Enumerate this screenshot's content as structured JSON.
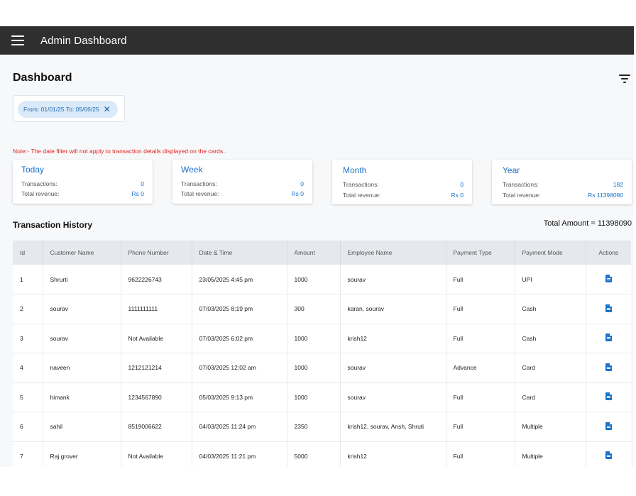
{
  "appbar": {
    "title": "Admin Dashboard",
    "menu_icon": "hamburger-menu-icon"
  },
  "page": {
    "title": "Dashboard",
    "filter_icon": "filter-list-icon"
  },
  "date_filter": {
    "chip_label": "From: 01/01/25 To: 05/06/25",
    "close_glyph": "✕"
  },
  "note": "Note:- The date filter will not apply to transaction details displayed on the cards..",
  "cards": [
    {
      "title": "Today",
      "transactions_label": "Transactions:",
      "transactions": "0",
      "revenue_label": "Total revenue:",
      "revenue": "Rs 0"
    },
    {
      "title": "Week",
      "transactions_label": "Transactions:",
      "transactions": "0",
      "revenue_label": "Total revenue:",
      "revenue": "Rs 0"
    },
    {
      "title": "Month",
      "transactions_label": "Transactions:",
      "transactions": "0",
      "revenue_label": "Total revenue:",
      "revenue": "Rs 0"
    },
    {
      "title": "Year",
      "transactions_label": "Transactions:",
      "transactions": "182",
      "revenue_label": "Total revenue:",
      "revenue": "Rs 11398090"
    }
  ],
  "history": {
    "title": "Transaction History",
    "total_amount": "Total Amount = 11398090"
  },
  "table": {
    "columns": [
      "Id",
      "Customer Name",
      "Phone Number",
      "Date & Time",
      "Amount",
      "Employee Name",
      "Payment Type",
      "Payment Mode",
      "Actions"
    ],
    "action_icon": "document-icon",
    "rows": [
      [
        "1",
        "Shrurti",
        "9622226743",
        "23/05/2025 4:45 pm",
        "1000",
        "sourav",
        "Full",
        "UPI"
      ],
      [
        "2",
        "sourav",
        "1111111111",
        "07/03/2025 8:19 pm",
        "300",
        "karan, sourav",
        "Full",
        "Cash"
      ],
      [
        "3",
        "sourav",
        "Not Available",
        "07/03/2025 6:02 pm",
        "1000",
        "krish12",
        "Full",
        "Cash"
      ],
      [
        "4",
        "naveen",
        "1212121214",
        "07/03/2025 12:02 am",
        "1000",
        "sourav",
        "Advance",
        "Card"
      ],
      [
        "5",
        "himank",
        "1234567890",
        "05/03/2025 9:13 pm",
        "1000",
        "sourav",
        "Full",
        "Card"
      ],
      [
        "6",
        "sahil",
        "8519006622",
        "04/03/2025 11:24 pm",
        "2350",
        "krish12, sourav, Ansh, Shruti",
        "Full",
        "Multiple"
      ],
      [
        "7",
        "Raj grover",
        "Not Available",
        "04/03/2025 11:21 pm",
        "5000",
        "krish12",
        "Full",
        "Multiple"
      ]
    ]
  },
  "colors": {
    "appbar": "#2f2f2f",
    "accent": "#1d72c9",
    "note": "#e0241b",
    "chip_bg": "#dbeaf8"
  }
}
